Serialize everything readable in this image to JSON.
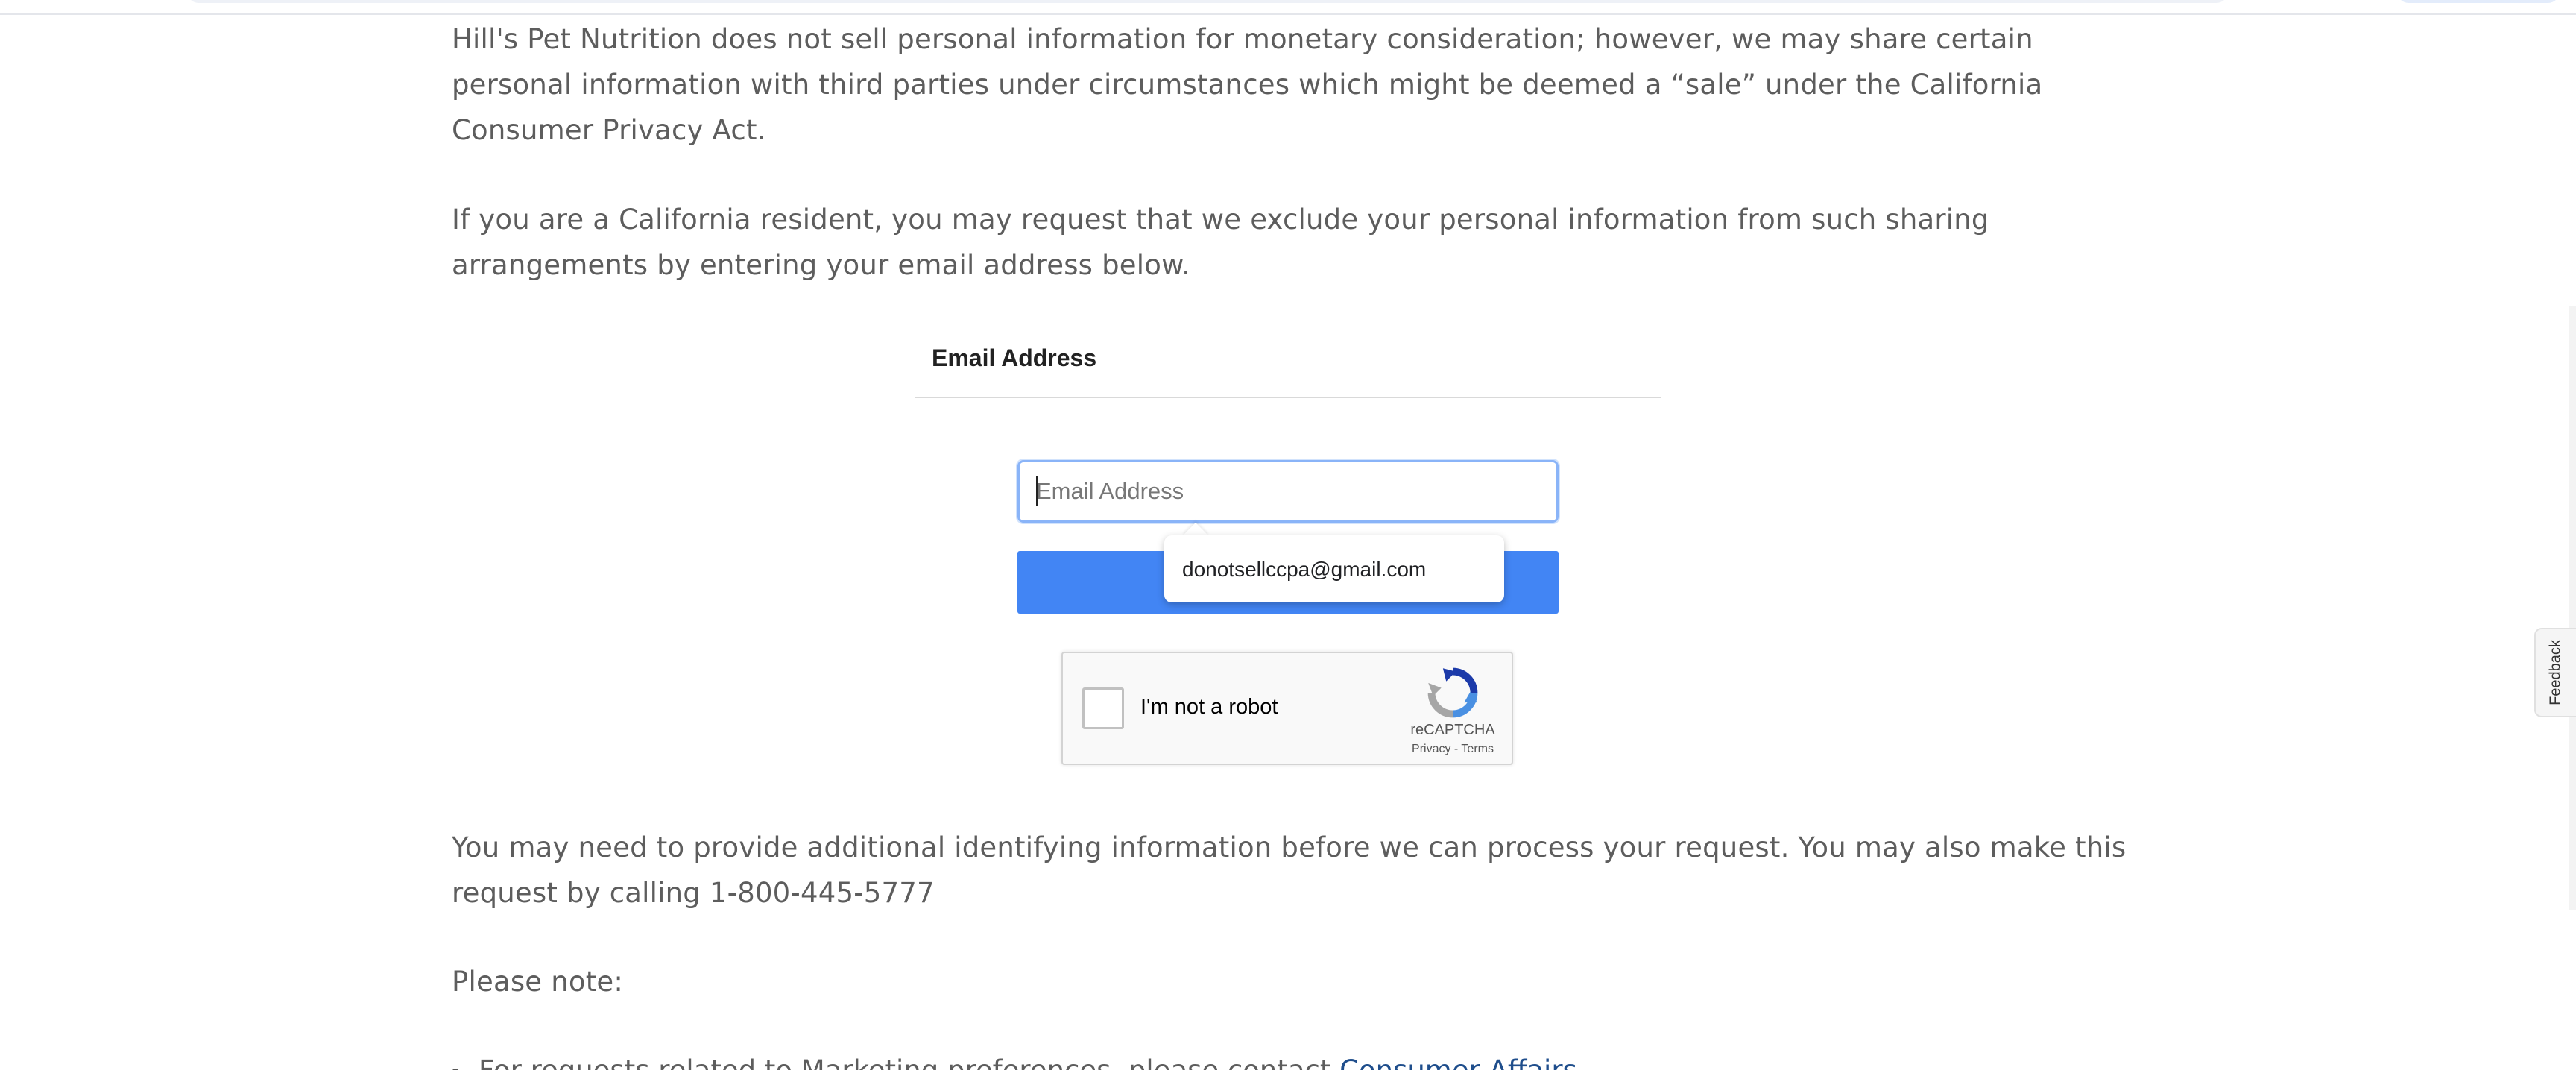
{
  "paragraphs": {
    "p1": "Hill's Pet Nutrition does not sell personal information for monetary consideration; however, we may share certain personal information with third parties under circumstances which might be deemed a “sale” under the California Consumer Privacy Act.",
    "p2": "If you are a California resident, you may request that we exclude your personal information from such sharing arrangements by entering your email address below.",
    "p3": "You may need to provide additional identifying information before we can process your request.  You may also make this request by calling 1-800-445-5777",
    "p4": "Please note:"
  },
  "bullet": {
    "text": "For requests related to Marketing preferences, please contact ",
    "link": "Consumer Affairs"
  },
  "form": {
    "label": "Email Address",
    "email_placeholder": "Email Address",
    "email_value": "",
    "submit_label": "",
    "autofill_suggestion": "donotsellccpa@gmail.com"
  },
  "recaptcha": {
    "label": "I'm not a robot",
    "brand": "reCAPTCHA",
    "links": "Privacy - Terms",
    "icon": "recaptcha-logo-icon"
  },
  "feedback": {
    "label": "Feedback"
  },
  "colors": {
    "button": "#4285f4",
    "input_focus": "#8ab4f8",
    "link": "#1f4e8c",
    "body_text": "#5d5d5d"
  }
}
